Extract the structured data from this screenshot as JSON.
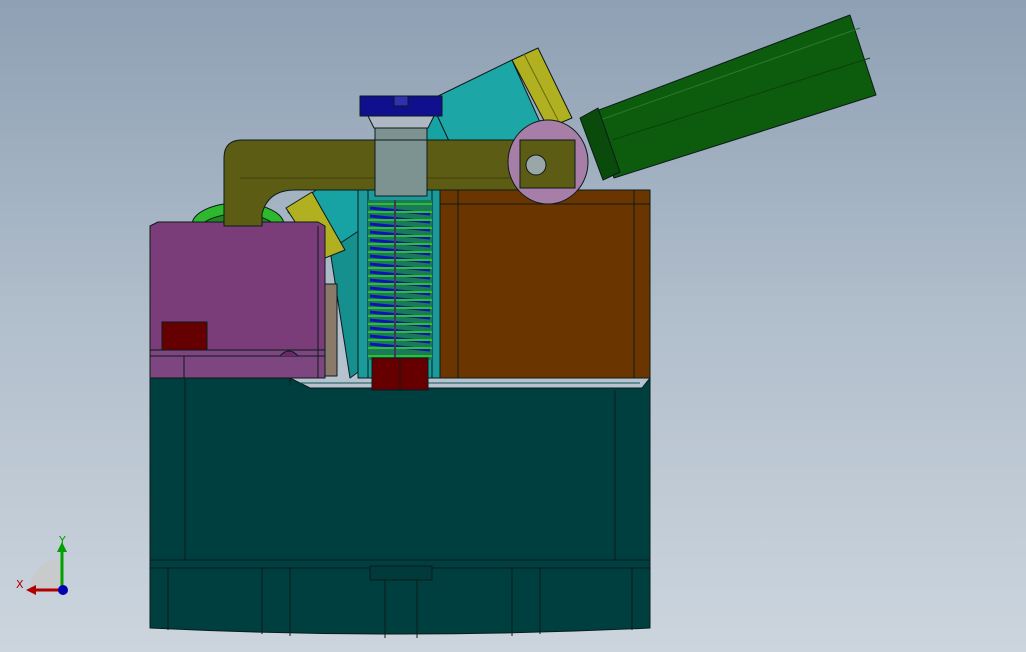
{
  "viewport": {
    "background_top": "#8ea0b4",
    "background_bottom": "#ccd5de"
  },
  "model": {
    "colors": {
      "base_block": "#003f3f",
      "purple_block": "#7a3d7a",
      "orange_block": "#6b3500",
      "olive_lever": "#5c5c14",
      "teal_cylinder": "#1ca6a6",
      "yellow_ring": "#b0b021",
      "green_rod": "#0d5c0d",
      "green_wheel": "#2db82d",
      "pivot_disc": "#a77ea7",
      "blue_cap": "#10108f",
      "grey_guide": "#7c9392",
      "spring_green": "#2cc02c",
      "spring_blue": "#1212b4",
      "dark_red_nut": "#660000",
      "tan_plate": "#8a7a6a"
    }
  },
  "triad": {
    "x_label": "X",
    "y_label": "Y",
    "x_color": "#b00000",
    "y_color": "#00a000",
    "z_color": "#0000b0"
  }
}
